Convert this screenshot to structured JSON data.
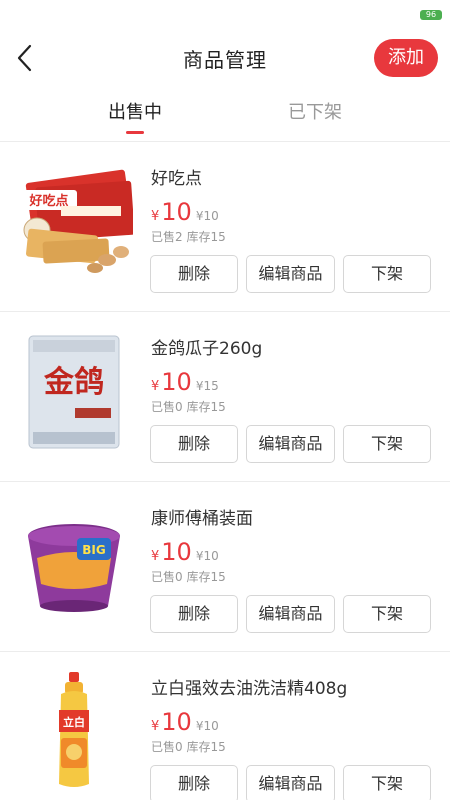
{
  "status_bar": {
    "battery": "96"
  },
  "header": {
    "title": "商品管理",
    "add_label": "添加"
  },
  "tabs": [
    {
      "label": "出售中"
    },
    {
      "label": "已下架"
    }
  ],
  "products": [
    {
      "name": "好吃点",
      "currency": "¥",
      "price": "10",
      "original_price": "¥10",
      "stats": "已售2 库存15",
      "delete_label": "删除",
      "edit_label": "编辑商品",
      "offshelf_label": "下架",
      "image_text": "好吃点"
    },
    {
      "name": "金鸽瓜子260g",
      "currency": "¥",
      "price": "10",
      "original_price": "¥15",
      "stats": "已售0 库存15",
      "delete_label": "删除",
      "edit_label": "编辑商品",
      "offshelf_label": "下架",
      "image_text": "金鸽"
    },
    {
      "name": "康师傅桶装面",
      "currency": "¥",
      "price": "10",
      "original_price": "¥10",
      "stats": "已售0 库存15",
      "delete_label": "删除",
      "edit_label": "编辑商品",
      "offshelf_label": "下架",
      "image_text": "BIG"
    },
    {
      "name": "立白强效去油洗洁精408g",
      "currency": "¥",
      "price": "10",
      "original_price": "¥10",
      "stats": "已售0 库存15",
      "delete_label": "删除",
      "edit_label": "编辑商品",
      "offshelf_label": "下架",
      "image_text": "立白"
    }
  ],
  "colors": {
    "accent": "#e8383d",
    "battery": "#4caf50"
  }
}
